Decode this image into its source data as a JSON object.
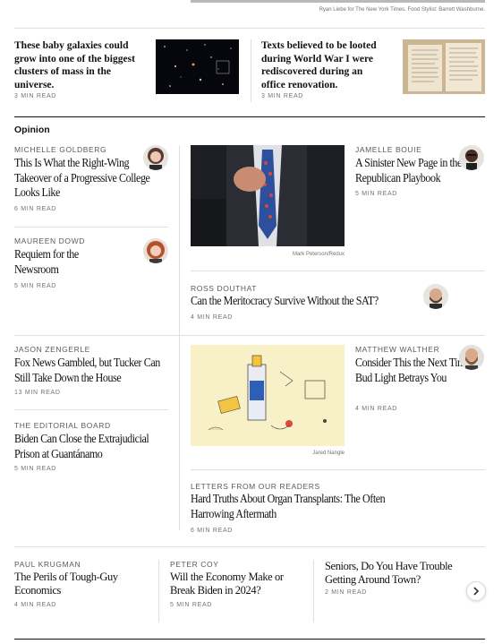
{
  "top": {
    "credit": "Ryan Liebe for The New York Times. Food Stylist: Barrett Washburne.",
    "stories": [
      {
        "headline": "These baby galaxies could grow into one of the biggest clusters of mass in the universe.",
        "meta": "3 MIN READ"
      },
      {
        "headline": "Texts believed to be looted during World War I were rediscovered during an office renovation.",
        "meta": "3 MIN READ"
      }
    ]
  },
  "opinion": {
    "section_label": "Opinion",
    "items": [
      {
        "author": "MICHELLE GOLDBERG",
        "headline": "This Is What the Right-Wing Takeover of a Progressive College Looks Like",
        "meta": "6 MIN READ"
      },
      {
        "author": "MAUREEN DOWD",
        "headline": "Requiem for the Newsroom",
        "meta": "5 MIN READ"
      },
      {
        "author": "JAMELLE BOUIE",
        "headline": "A Sinister New Page in the Republican Playbook",
        "meta": "5 MIN READ"
      },
      {
        "author": "ROSS DOUTHAT",
        "headline": "Can the Meritocracy Survive Without the SAT?",
        "meta": "4 MIN READ"
      },
      {
        "author": "JASON ZENGERLE",
        "headline": "Fox News Gambled, but Tucker Can Still Take Down the House",
        "meta": "13 MIN READ"
      },
      {
        "author": "THE EDITORIAL BOARD",
        "headline": "Biden Can Close the Extrajudicial Prison at Guantánamo",
        "meta": "5 MIN READ"
      },
      {
        "author": "MATTHEW WALTHER",
        "headline": "Consider This the Next Time Bud Light Betrays You",
        "meta": "4 MIN READ"
      },
      {
        "author": "LETTERS FROM OUR READERS",
        "headline": "Hard Truths About Organ Transplants: The Often Harrowing Aftermath",
        "meta": "6 MIN READ"
      }
    ],
    "image_credits": [
      "Mark Peterson/Redux",
      "Jared Nangle"
    ]
  },
  "carousel": {
    "items": [
      {
        "author": "PAUL KRUGMAN",
        "headline": "The Perils of Tough-Guy Economics",
        "meta": "4 MIN READ"
      },
      {
        "author": "PETER COY",
        "headline": "Will the Economy Make or Break Biden in 2024?",
        "meta": "5 MIN READ"
      },
      {
        "author": "",
        "headline": "Seniors, Do You Have Trouble Getting Around Town?",
        "meta": "2 MIN READ"
      }
    ],
    "next_icon": "chevron-right-icon"
  }
}
